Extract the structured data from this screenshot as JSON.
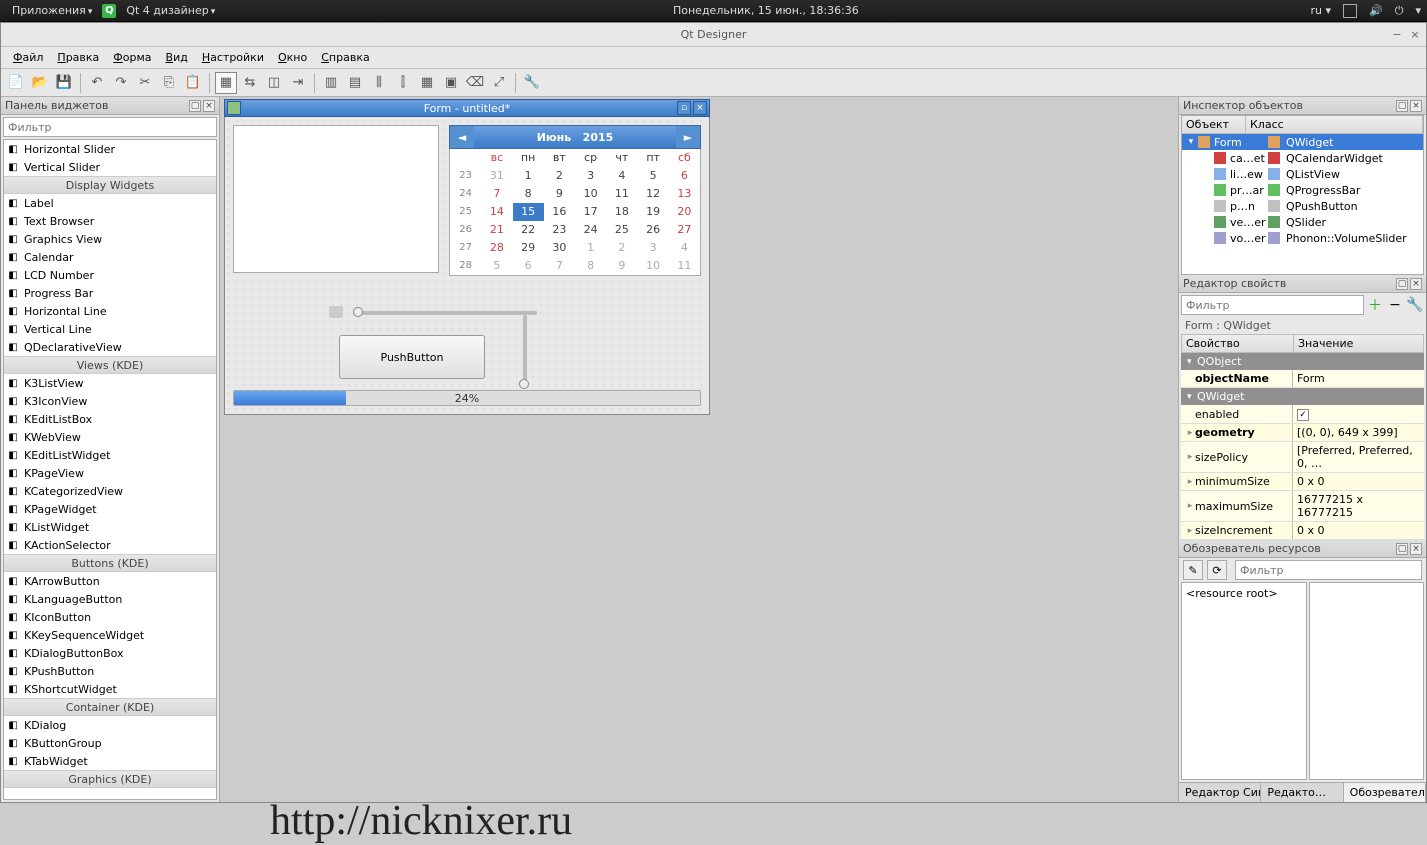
{
  "taskbar": {
    "apps": "Приложения",
    "running": "Qt 4 дизайнер",
    "clock": "Понедельник, 15 июн., 18:36:36",
    "lang": "ru"
  },
  "app": {
    "title": "Qt Designer",
    "menu": [
      "Файл",
      "Правка",
      "Форма",
      "Вид",
      "Настройки",
      "Окно",
      "Справка"
    ]
  },
  "widgetbox": {
    "title": "Панель виджетов",
    "filter_ph": "Фильтр",
    "items": [
      {
        "type": "item",
        "label": "Horizontal Slider"
      },
      {
        "type": "item",
        "label": "Vertical Slider"
      },
      {
        "type": "cat",
        "label": "Display Widgets"
      },
      {
        "type": "item",
        "label": "Label"
      },
      {
        "type": "item",
        "label": "Text Browser"
      },
      {
        "type": "item",
        "label": "Graphics View"
      },
      {
        "type": "item",
        "label": "Calendar"
      },
      {
        "type": "item",
        "label": "LCD Number"
      },
      {
        "type": "item",
        "label": "Progress Bar"
      },
      {
        "type": "item",
        "label": "Horizontal Line"
      },
      {
        "type": "item",
        "label": "Vertical Line"
      },
      {
        "type": "item",
        "label": "QDeclarativeView"
      },
      {
        "type": "cat",
        "label": "Views (KDE)"
      },
      {
        "type": "item",
        "label": "K3ListView"
      },
      {
        "type": "item",
        "label": "K3IconView"
      },
      {
        "type": "item",
        "label": "KEditListBox"
      },
      {
        "type": "item",
        "label": "KWebView"
      },
      {
        "type": "item",
        "label": "KEditListWidget"
      },
      {
        "type": "item",
        "label": "KPageView"
      },
      {
        "type": "item",
        "label": "KCategorizedView"
      },
      {
        "type": "item",
        "label": "KPageWidget"
      },
      {
        "type": "item",
        "label": "KListWidget"
      },
      {
        "type": "item",
        "label": "KActionSelector"
      },
      {
        "type": "cat",
        "label": "Buttons (KDE)"
      },
      {
        "type": "item",
        "label": "KArrowButton"
      },
      {
        "type": "item",
        "label": "KLanguageButton"
      },
      {
        "type": "item",
        "label": "KIconButton"
      },
      {
        "type": "item",
        "label": "KKeySequenceWidget"
      },
      {
        "type": "item",
        "label": "KDialogButtonBox"
      },
      {
        "type": "item",
        "label": "KPushButton"
      },
      {
        "type": "item",
        "label": "KShortcutWidget"
      },
      {
        "type": "cat",
        "label": "Container (KDE)"
      },
      {
        "type": "item",
        "label": "KDialog"
      },
      {
        "type": "item",
        "label": "KButtonGroup"
      },
      {
        "type": "item",
        "label": "KTabWidget"
      },
      {
        "type": "cat",
        "label": "Graphics (KDE)"
      }
    ]
  },
  "form": {
    "title": "Form - untitled*",
    "cal": {
      "month": "Июнь",
      "year": "2015",
      "days": [
        "вс",
        "пн",
        "вт",
        "ср",
        "чт",
        "пт",
        "сб"
      ],
      "weeks": [
        "23",
        "24",
        "25",
        "26",
        "27",
        "28"
      ],
      "grid": [
        [
          {
            "d": "31",
            "c": "gray"
          },
          {
            "d": "1"
          },
          {
            "d": "2"
          },
          {
            "d": "3"
          },
          {
            "d": "4"
          },
          {
            "d": "5"
          },
          {
            "d": "6",
            "c": "red"
          }
        ],
        [
          {
            "d": "7",
            "c": "red"
          },
          {
            "d": "8"
          },
          {
            "d": "9"
          },
          {
            "d": "10"
          },
          {
            "d": "11"
          },
          {
            "d": "12"
          },
          {
            "d": "13",
            "c": "red"
          }
        ],
        [
          {
            "d": "14",
            "c": "red"
          },
          {
            "d": "15",
            "c": "sel"
          },
          {
            "d": "16"
          },
          {
            "d": "17"
          },
          {
            "d": "18"
          },
          {
            "d": "19"
          },
          {
            "d": "20",
            "c": "red"
          }
        ],
        [
          {
            "d": "21",
            "c": "red"
          },
          {
            "d": "22"
          },
          {
            "d": "23"
          },
          {
            "d": "24"
          },
          {
            "d": "25"
          },
          {
            "d": "26"
          },
          {
            "d": "27",
            "c": "red"
          }
        ],
        [
          {
            "d": "28",
            "c": "red"
          },
          {
            "d": "29"
          },
          {
            "d": "30"
          },
          {
            "d": "1",
            "c": "gray"
          },
          {
            "d": "2",
            "c": "gray"
          },
          {
            "d": "3",
            "c": "gray"
          },
          {
            "d": "4",
            "c": "gray"
          }
        ],
        [
          {
            "d": "5",
            "c": "gray"
          },
          {
            "d": "6",
            "c": "gray"
          },
          {
            "d": "7",
            "c": "gray"
          },
          {
            "d": "8",
            "c": "gray"
          },
          {
            "d": "9",
            "c": "gray"
          },
          {
            "d": "10",
            "c": "gray"
          },
          {
            "d": "11",
            "c": "gray"
          }
        ]
      ]
    },
    "pushbtn": "PushButton",
    "progress": "24%"
  },
  "inspector": {
    "title": "Инспектор объектов",
    "cols": [
      "Объект",
      "Класс"
    ],
    "rows": [
      {
        "name": "Form",
        "cls": "QWidget",
        "ic": "form",
        "sel": true,
        "ind": 0
      },
      {
        "name": "ca…et",
        "cls": "QCalendarWidget",
        "ic": "cal",
        "ind": 1
      },
      {
        "name": "li…ew",
        "cls": "QListView",
        "ic": "list",
        "ind": 1
      },
      {
        "name": "pr…ar",
        "cls": "QProgressBar",
        "ic": "prog",
        "ind": 1
      },
      {
        "name": "p…n",
        "cls": "QPushButton",
        "ic": "btn",
        "ind": 1
      },
      {
        "name": "ve…er",
        "cls": "QSlider",
        "ic": "slid",
        "ind": 1
      },
      {
        "name": "vo…er",
        "cls": "Phonon::VolumeSlider",
        "ic": "vol",
        "ind": 1
      }
    ]
  },
  "props": {
    "title": "Редактор свойств",
    "filter_ph": "Фильтр",
    "classline": "Form : QWidget",
    "cols": [
      "Свойство",
      "Значение"
    ],
    "groups": [
      {
        "grp": "QObject",
        "rows": [
          {
            "n": "objectName",
            "v": "Form",
            "bold": true
          }
        ]
      },
      {
        "grp": "QWidget",
        "rows": [
          {
            "n": "enabled",
            "v": "",
            "chk": true
          },
          {
            "n": "geometry",
            "v": "[(0, 0), 649 x 399]",
            "exp": true,
            "bold": true
          },
          {
            "n": "sizePolicy",
            "v": "[Preferred, Preferred, 0, …",
            "exp": true
          },
          {
            "n": "minimumSize",
            "v": "0 x 0",
            "exp": true
          },
          {
            "n": "maximumSize",
            "v": "16777215 x 16777215",
            "exp": true
          },
          {
            "n": "sizeIncrement",
            "v": "0 x 0",
            "exp": true
          }
        ]
      }
    ]
  },
  "res": {
    "title": "Обозреватель ресурсов",
    "filter_ph": "Фильтр",
    "root": "<resource root>",
    "tabs": [
      "Редактор Сигнал…",
      "Редакто…",
      "Обозревател…"
    ]
  },
  "watermark": "http://nicknixer.ru"
}
